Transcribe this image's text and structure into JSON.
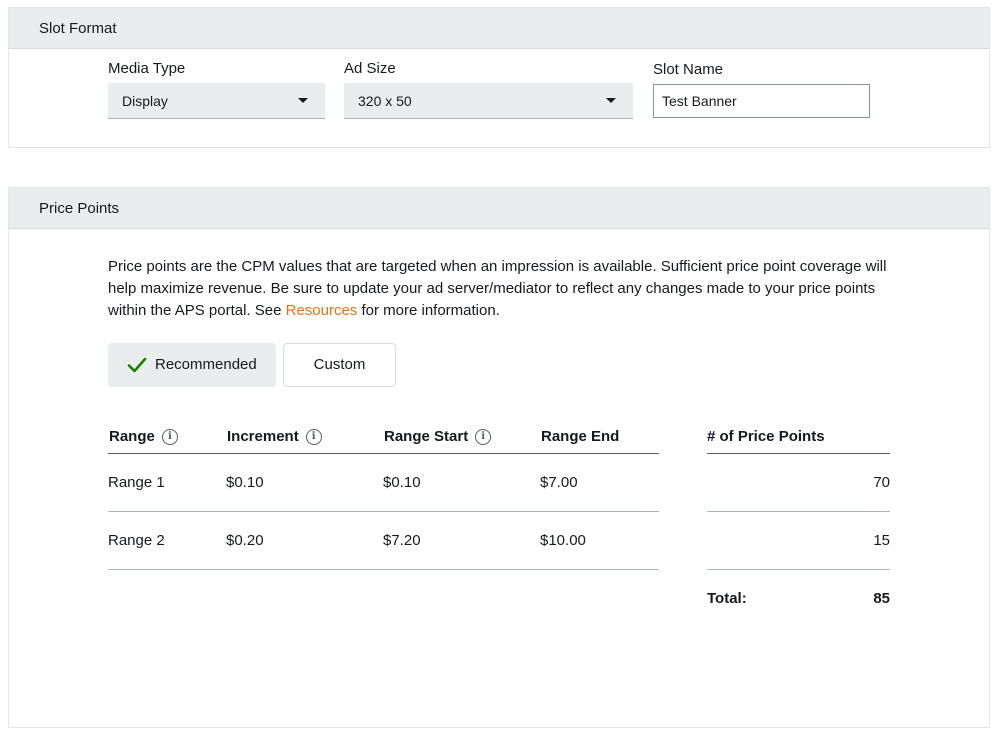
{
  "slot_format": {
    "header": "Slot Format",
    "media_type": {
      "label": "Media Type",
      "value": "Display"
    },
    "ad_size": {
      "label": "Ad Size",
      "value": "320 x 50"
    },
    "slot_name": {
      "label": "Slot Name",
      "value": "Test Banner"
    }
  },
  "price_points": {
    "header": "Price Points",
    "description_part1": "Price points are the CPM values that are targeted when an impression is available. Sufficient price point coverage will help maximize revenue. Be sure to update your ad server/mediator to reflect any changes made to your price points within the APS portal. See ",
    "resources_link": "Resources",
    "description_part2": " for more information.",
    "toggle": {
      "recommended": "Recommended",
      "custom": "Custom",
      "selected": "Recommended"
    },
    "table": {
      "columns": [
        "Range",
        "Increment",
        "Range Start",
        "Range End",
        "# of Price Points"
      ],
      "rows": [
        {
          "range": "Range 1",
          "increment": "$0.10",
          "start": "$0.10",
          "end": "$7.00",
          "count": "70"
        },
        {
          "range": "Range 2",
          "increment": "$0.20",
          "start": "$7.20",
          "end": "$10.00",
          "count": "15"
        }
      ],
      "total_label": "Total:",
      "total_value": "85"
    }
  },
  "colors": {
    "accent_link": "#ec7211",
    "check_green": "#1d8102",
    "header_bg": "#eaeded"
  },
  "icons": {
    "check": "check-icon",
    "info": "info-icon",
    "dropdown": "caret-down-icon"
  }
}
